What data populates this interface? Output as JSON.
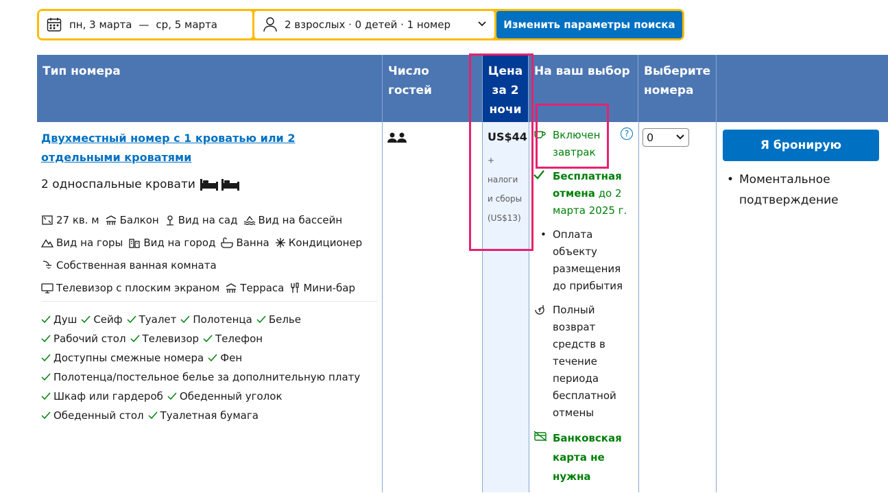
{
  "search": {
    "date_from": "пн, 3 марта",
    "dash": "—",
    "date_to": "ср, 5 марта",
    "guests": "2 взрослых · 0 детей · 1 номер",
    "button": "Изменить параметры поиска"
  },
  "table": {
    "headers": {
      "room_type": "Тип номера",
      "guests": "Число гостей",
      "price": "Цена за 2 ночи",
      "choice": "На ваш выбор",
      "select": "Выберите номера"
    },
    "room": {
      "name": "Двухместный номер с 1 кроватью или 2 отдельными кроватями",
      "beds": "2 односпальные кровати",
      "facilities": [
        [
          "27 кв. м",
          "Балкон",
          "Вид на сад",
          "Вид на бассейн"
        ],
        [
          "Вид на горы",
          "Вид на город",
          "Ванна",
          "Кондиционер"
        ],
        [
          "Собственная ванная комната"
        ],
        [
          "Телевизор с плоским экраном",
          "Терраса",
          "Мини-бар"
        ]
      ],
      "amenities": [
        [
          "Душ",
          "Сейф",
          "Туалет",
          "Полотенца",
          "Белье"
        ],
        [
          "Рабочий стол",
          "Телевизор",
          "Телефон"
        ],
        [
          "Доступны смежные номера",
          "Фен"
        ],
        [
          "Полотенца/постельное белье за дополнительную плату"
        ],
        [
          "Шкаф или гардероб",
          "Обеденный уголок"
        ],
        [
          "Обеденный стол",
          "Туалетная бумага"
        ]
      ]
    },
    "price": {
      "amount": "US$44",
      "plus": "+",
      "taxes_line1": "налоги",
      "taxes_line2": "и сборы",
      "taxes_amount": "(US$13)"
    },
    "choice": {
      "breakfast": "Включен завтрак",
      "free_cancel_bold": "Бесплатная отмена",
      "free_cancel_rest": " до 2 марта 2025 г.",
      "pay_at_property": "Оплата объекту размещения до прибытия",
      "refund": "Полный возврат средств в течение периода бесплатной отмены",
      "no_card": "Банковская карта не нужна",
      "help": "?"
    },
    "select": {
      "value": "0"
    },
    "book": {
      "button": "Я бронирую",
      "instant": "Моментальное подтверждение"
    }
  },
  "colors": {
    "header_bg": "#4c76b2",
    "price_header_bg": "#003b95",
    "primary": "#0071c2",
    "green": "#008009",
    "highlight": "#e6226e",
    "search_border": "#febb02"
  }
}
